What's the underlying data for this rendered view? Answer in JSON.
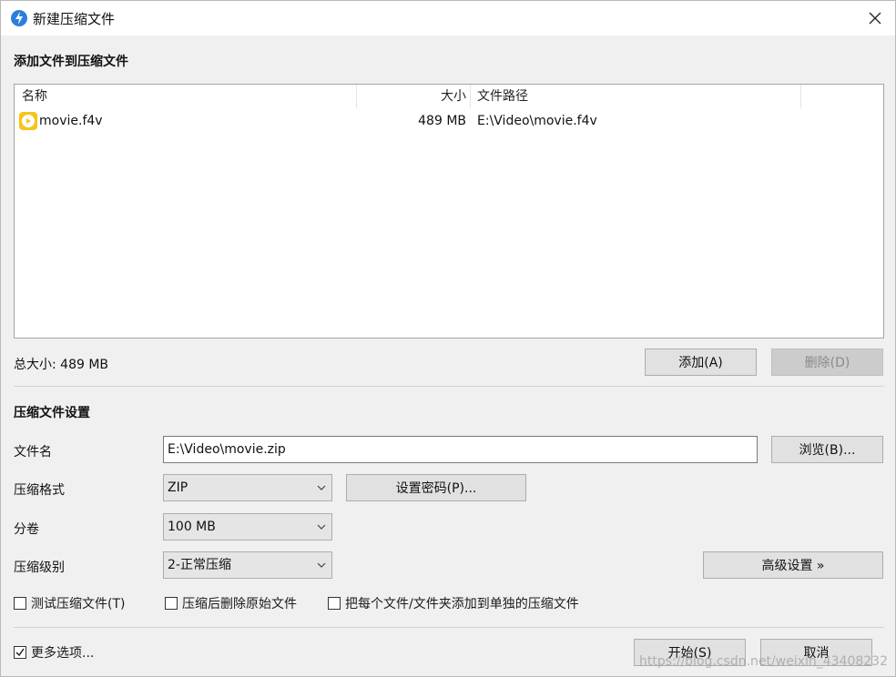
{
  "window": {
    "title": "新建压缩文件",
    "close_label": "×"
  },
  "files_section": {
    "title": "添加文件到压缩文件",
    "columns": {
      "name": "名称",
      "size": "大小",
      "path": "文件路径"
    },
    "rows": [
      {
        "name": "movie.f4v",
        "size": "489 MB",
        "path": "E:\\Video\\movie.f4v",
        "icon": "video-file-icon"
      }
    ],
    "total_label": "总大小: 489 MB",
    "add_button": "添加(A)",
    "delete_button": "删除(D)"
  },
  "settings": {
    "title": "压缩文件设置",
    "filename_label": "文件名",
    "filename_value": "E:\\Video\\movie.zip",
    "browse_button": "浏览(B)...",
    "format_label": "压缩格式",
    "format_value": "ZIP",
    "password_button": "设置密码(P)...",
    "split_label": "分卷",
    "split_value": "100 MB",
    "level_label": "压缩级别",
    "level_value": "2-正常压缩",
    "advanced_button": "高级设置 »",
    "checkboxes": [
      {
        "label": "测试压缩文件(T)",
        "checked": false
      },
      {
        "label": "压缩后删除原始文件",
        "checked": false
      },
      {
        "label": "把每个文件/文件夹添加到单独的压缩文件",
        "checked": false
      }
    ]
  },
  "footer": {
    "more_options_label": "更多选项...",
    "more_options_checked": true,
    "start_button": "开始(S)",
    "cancel_button": "取消"
  },
  "watermark": "https://blog.csdn.net/weixin_43408232",
  "colors": {
    "app_icon": "#2c7fd8",
    "file_icon": "#f5c518"
  }
}
